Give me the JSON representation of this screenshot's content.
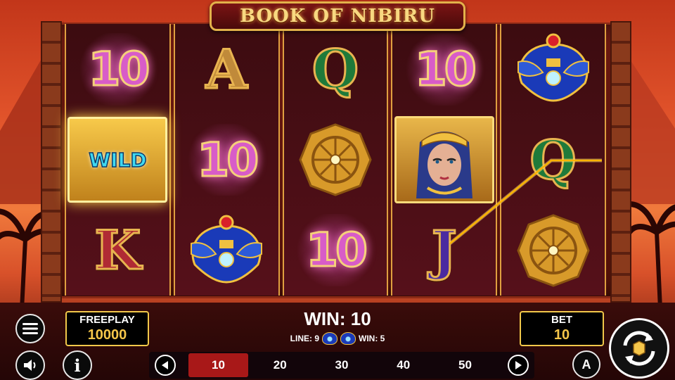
{
  "game": {
    "title": "BOOK OF NIBIRU"
  },
  "reels": [
    [
      {
        "type": "number",
        "text": "10"
      },
      {
        "type": "wild",
        "text": "WILD"
      },
      {
        "type": "letter",
        "text": "K",
        "style": "k"
      }
    ],
    [
      {
        "type": "letter",
        "text": "A",
        "style": "a"
      },
      {
        "type": "number",
        "text": "10"
      },
      {
        "type": "scarab",
        "icon": "scarab-icon"
      }
    ],
    [
      {
        "type": "letter",
        "text": "Q",
        "style": "q"
      },
      {
        "type": "medallion",
        "icon": "sun-medallion-icon"
      },
      {
        "type": "number",
        "text": "10"
      }
    ],
    [
      {
        "type": "number",
        "text": "10"
      },
      {
        "type": "pharaoh",
        "icon": "cleopatra-portrait-icon"
      },
      {
        "type": "letter",
        "text": "J",
        "style": "j"
      }
    ],
    [
      {
        "type": "scarab",
        "icon": "scarab-icon"
      },
      {
        "type": "letter",
        "text": "Q",
        "style": "q"
      },
      {
        "type": "medallion",
        "icon": "sun-medallion-icon"
      }
    ]
  ],
  "hud": {
    "freeplay_label": "FREEPLAY",
    "freeplay_value": "10000",
    "win_text": "WIN: 10",
    "line_text": "LINE: 9",
    "line_win_text": "WIN: 5",
    "bet_label": "BET",
    "bet_value": "10",
    "bet_options": [
      "10",
      "20",
      "30",
      "40",
      "50"
    ],
    "bet_selected": "10",
    "auto_label": "A"
  },
  "colors": {
    "accent_gold": "#f1c84a",
    "win_line": "#ffb400",
    "bet_active": "#a81818"
  }
}
